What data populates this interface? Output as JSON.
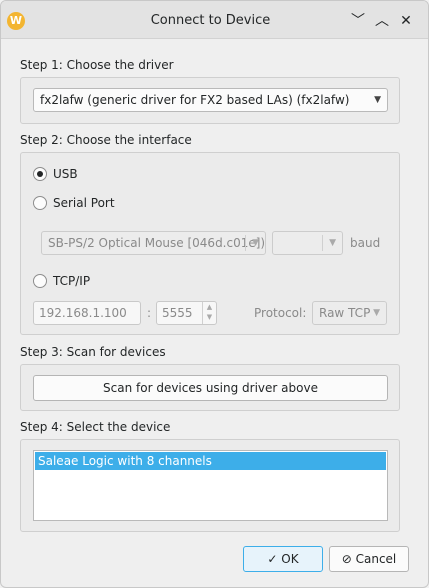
{
  "window": {
    "title": "Connect to Device",
    "app_icon_letter": "W"
  },
  "title_buttons": {
    "minimize": "﹀",
    "maximize": "︿",
    "close": "✕"
  },
  "step1": {
    "label": "Step 1: Choose the driver",
    "driver_selected": "fx2lafw (generic driver for FX2 based LAs) (fx2lafw)"
  },
  "step2": {
    "label": "Step 2: Choose the interface",
    "usb_label": "USB",
    "serial_label": "Serial Port",
    "serial_port_value": "SB-PS/2 Optical Mouse [046d.c01e])",
    "baud_value": "",
    "baud_label": "baud",
    "tcp_label": "TCP/IP",
    "host_value": "192.168.1.100",
    "colon": ":",
    "port_value": "5555",
    "protocol_label": "Protocol:",
    "protocol_value": "Raw TCP"
  },
  "step3": {
    "label": "Step 3: Scan for devices",
    "scan_button": "Scan for devices using driver above"
  },
  "step4": {
    "label": "Step 4: Select the device",
    "devices": [
      "Saleae Logic with 8 channels"
    ]
  },
  "buttons": {
    "ok": "OK",
    "cancel": "Cancel"
  },
  "colors": {
    "accent": "#3daee9",
    "app_icon": "#f3b531"
  }
}
